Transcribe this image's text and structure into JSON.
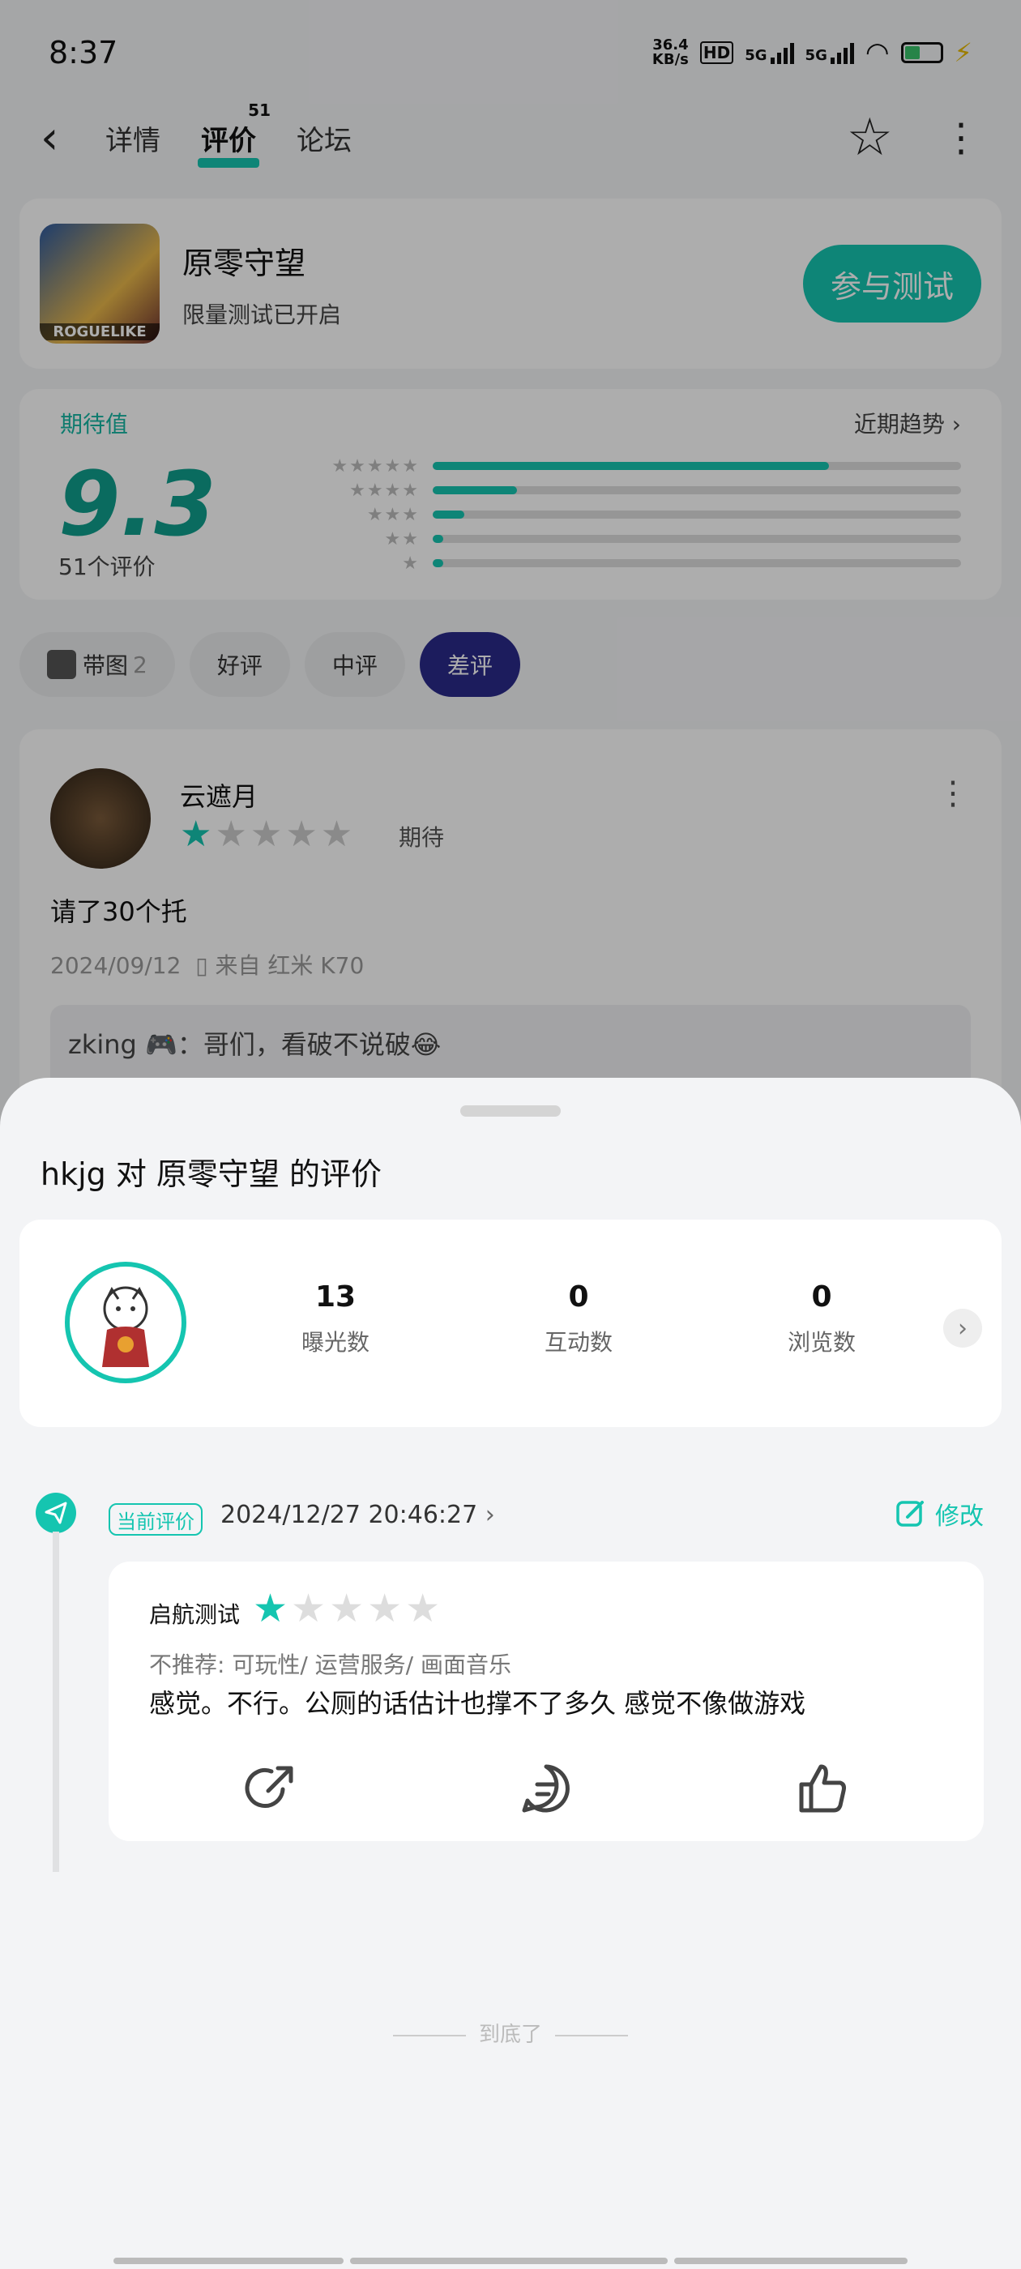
{
  "status": {
    "time": "8:37",
    "net_speed": "36.4",
    "net_unit": "KB/s",
    "hd": "HD",
    "sig1": "5G",
    "sig2": "5G"
  },
  "nav": {
    "tabs": [
      {
        "label": "详情"
      },
      {
        "label": "评价",
        "badge": "51"
      },
      {
        "label": "论坛"
      }
    ]
  },
  "game": {
    "title": "原零守望",
    "subtitle": "限量测试已开启",
    "icon_label": "ROGUELIKE",
    "cta": "参与测试"
  },
  "rating": {
    "label": "期待值",
    "trend": "近期趋势",
    "score": "9.3",
    "count": "51个评价",
    "distribution": [
      {
        "stars": "★★★★★",
        "fraction": 0.75
      },
      {
        "stars": "★★★★",
        "fraction": 0.16
      },
      {
        "stars": "★★★",
        "fraction": 0.06
      },
      {
        "stars": "★★",
        "fraction": 0.02
      },
      {
        "stars": "★",
        "fraction": 0.02
      }
    ]
  },
  "filters": [
    {
      "label": "带图",
      "count": "2"
    },
    {
      "label": "好评"
    },
    {
      "label": "中评"
    },
    {
      "label": "差评",
      "active": true
    }
  ],
  "review": {
    "username": "云遮月",
    "rating": 1,
    "tag": "期待",
    "text": "请了30个托",
    "date": "2024/09/12",
    "device": "来自 红米 K70",
    "reply_user": "zking",
    "reply_text": "：哥们，看破不说破😂"
  },
  "sheet": {
    "title": "hkjg 对 原零守望 的评价",
    "stats": [
      {
        "value": "13",
        "label": "曝光数"
      },
      {
        "value": "0",
        "label": "互动数"
      },
      {
        "value": "0",
        "label": "浏览数"
      }
    ],
    "current_tag": "当前评价",
    "current_date": "2024/12/27 20:46:27",
    "edit_label": "修改",
    "my_review": {
      "category": "启航测试",
      "rating": 1,
      "tags": "不推荐: 可玩性/ 运营服务/ 画面音乐",
      "text": "感觉。不行。公厕的话估计也撑不了多久 感觉不像做游戏"
    },
    "end_text": "到底了"
  },
  "colors": {
    "accent": "#15c5b0",
    "active_chip": "#2a2a8a"
  }
}
